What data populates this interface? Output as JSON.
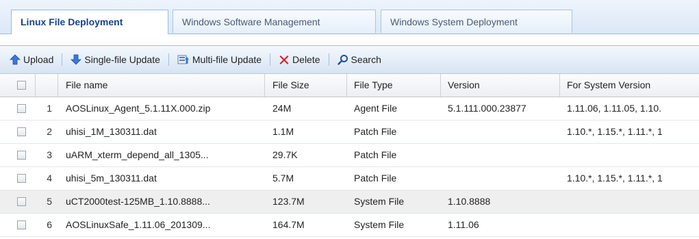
{
  "tabs": [
    {
      "label": "Linux File Deployment",
      "active": true
    },
    {
      "label": "Windows Software Management",
      "active": false
    },
    {
      "label": "Windows System Deployment",
      "active": false
    }
  ],
  "toolbar": {
    "upload": "Upload",
    "single_update": "Single-file Update",
    "multi_update": "Multi-file Update",
    "delete": "Delete",
    "search": "Search"
  },
  "columns": {
    "file_name": "File name",
    "file_size": "File Size",
    "file_type": "File Type",
    "version": "Version",
    "for_system_version": "For System Version"
  },
  "rows": [
    {
      "num": "1",
      "name": "AOSLinux_Agent_5.1.11X.000.zip",
      "size": "24M",
      "type": "Agent File",
      "version": "5.1.111.000.23877",
      "sysver": "1.11.06, 1.11.05, 1.10.",
      "selected": false
    },
    {
      "num": "2",
      "name": "uhisi_1M_130311.dat",
      "size": "1.1M",
      "type": "Patch File",
      "version": "",
      "sysver": "1.10.*, 1.15.*, 1.11.*, 1",
      "selected": false
    },
    {
      "num": "3",
      "name": "uARM_xterm_depend_all_1305...",
      "size": "29.7K",
      "type": "Patch File",
      "version": "",
      "sysver": "",
      "selected": false
    },
    {
      "num": "4",
      "name": "uhisi_5m_130311.dat",
      "size": "5.7M",
      "type": "Patch File",
      "version": "",
      "sysver": "1.10.*, 1.15.*, 1.11.*, 1",
      "selected": false
    },
    {
      "num": "5",
      "name": "uCT2000test-125MB_1.10.8888...",
      "size": "123.7M",
      "type": "System File",
      "version": "1.10.8888",
      "sysver": "",
      "selected": true
    },
    {
      "num": "6",
      "name": "AOSLinuxSafe_1.11.06_201309...",
      "size": "164.7M",
      "type": "System File",
      "version": "1.11.06",
      "sysver": "",
      "selected": false
    }
  ],
  "colors": {
    "accent": "#15428b",
    "header_border": "#99bbe8",
    "delete_red": "#d62020",
    "icon_blue": "#3a77d8"
  },
  "icons": [
    "upload-icon",
    "single-update-icon",
    "multi-update-icon",
    "delete-icon",
    "search-icon"
  ]
}
